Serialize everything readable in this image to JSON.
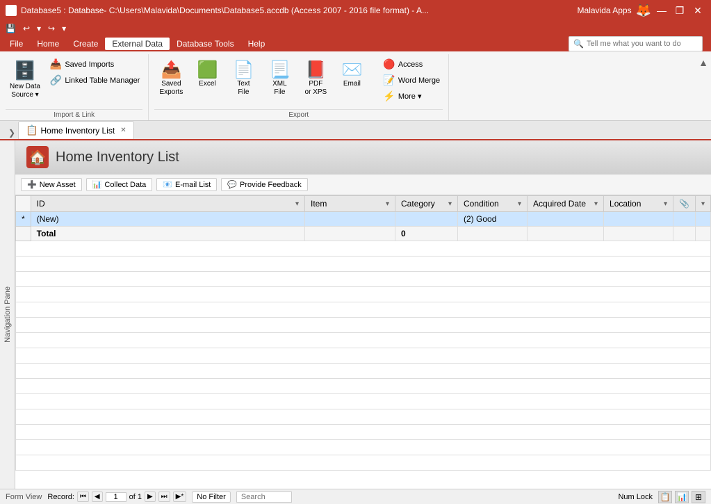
{
  "titleBar": {
    "title": "Database5 : Database- C:\\Users\\Malavida\\Documents\\Database5.accdb (Access 2007 - 2016 file format) - A...",
    "appName": "Malavida Apps",
    "closeBtn": "✕",
    "minimizeBtn": "—",
    "maximizeBtn": "❐"
  },
  "quickAccess": {
    "saveBtn": "💾",
    "undoBtn": "↩",
    "redoBtn": "↪",
    "dropBtn": "▾"
  },
  "menuBar": {
    "items": [
      "File",
      "Home",
      "Create",
      "External Data",
      "Database Tools",
      "Help"
    ]
  },
  "ribbon": {
    "activeTab": "External Data",
    "groups": [
      {
        "label": "Import & Link",
        "items": [
          {
            "id": "new-data-source",
            "label": "New Data\nSource",
            "type": "large-drop"
          },
          {
            "id": "saved-imports",
            "label": "Saved Imports",
            "type": "small"
          },
          {
            "id": "linked-table-manager",
            "label": "Linked Table Manager",
            "type": "small"
          }
        ]
      },
      {
        "label": "Export",
        "items": [
          {
            "id": "saved-exports",
            "label": "Saved\nExports",
            "type": "large"
          },
          {
            "id": "excel",
            "label": "Excel",
            "type": "large"
          },
          {
            "id": "text-file",
            "label": "Text\nFile",
            "type": "large"
          },
          {
            "id": "xml-file",
            "label": "XML\nFile",
            "type": "large"
          },
          {
            "id": "pdf-or-xps",
            "label": "PDF\nor XPS",
            "type": "large"
          },
          {
            "id": "email",
            "label": "Email",
            "type": "large"
          },
          {
            "id": "access",
            "label": "Access",
            "type": "small-right"
          },
          {
            "id": "word-merge",
            "label": "Word Merge",
            "type": "small-right"
          },
          {
            "id": "more",
            "label": "More▾",
            "type": "small-right"
          }
        ]
      }
    ],
    "searchPlaceholder": "Tell me what you want to do"
  },
  "tabs": [
    {
      "id": "home-inventory",
      "label": "Home Inventory List",
      "active": true,
      "icon": "📋"
    }
  ],
  "form": {
    "title": "Home Inventory List",
    "icon": "🏠",
    "toolbar": {
      "newAsset": "New Asset",
      "collectData": "Collect Data",
      "emailList": "E-mail List",
      "provideFeedback": "Provide Feedback"
    },
    "table": {
      "columns": [
        "ID",
        "Item",
        "Category",
        "Condition",
        "Acquired Date",
        "Location",
        "📎",
        ""
      ],
      "rows": [
        {
          "selector": "*",
          "id": "(New)",
          "item": "",
          "category": "",
          "condition": "(2) Good",
          "acquiredDate": "",
          "location": "",
          "attach": "",
          "extra": "",
          "type": "new"
        },
        {
          "selector": "",
          "id": "Total",
          "item": "",
          "category": "0",
          "condition": "",
          "acquiredDate": "",
          "location": "",
          "attach": "",
          "extra": "",
          "type": "total"
        }
      ]
    }
  },
  "statusBar": {
    "label": "Record:",
    "first": "⏮",
    "prev": "◀",
    "recordNum": "1",
    "ofLabel": "of 1",
    "next": "▶",
    "last": "⏭",
    "newRecord": "▶*",
    "noFilter": "No Filter",
    "searchPlaceholder": "Search",
    "viewLabel": "Form View",
    "numLock": "Num Lock"
  }
}
